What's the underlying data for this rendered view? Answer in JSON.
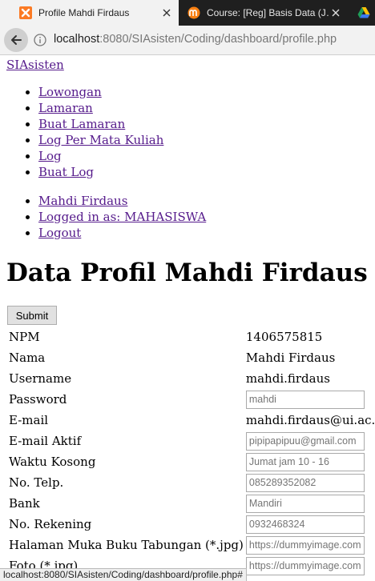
{
  "browser": {
    "tabs": [
      {
        "title": "Profile Mahdi Firdaus",
        "favicon": "xampp-icon"
      },
      {
        "title": "Course: [Reg] Basis Data (J…",
        "favicon": "moodle-icon"
      }
    ],
    "url": {
      "host": "localhost",
      "rest": ":8080/SIAsisten/Coding/dashboard/profile.php"
    },
    "status_url": "localhost:8080/SIAsisten/Coding/dashboard/profile.php#"
  },
  "nav": {
    "brand": "SIAsisten",
    "menu": [
      "Lowongan",
      "Lamaran",
      "Buat Lamaran",
      "Log Per Mata Kuliah",
      "Log",
      "Buat Log"
    ],
    "user_menu": [
      "Mahdi Firdaus",
      "Logged in as: MAHASISWA",
      "Logout"
    ]
  },
  "page": {
    "heading": "Data Profil Mahdi Firdaus",
    "submit_label": "Submit"
  },
  "profile": {
    "npm": {
      "label": "NPM",
      "value": "1406575815"
    },
    "nama": {
      "label": "Nama",
      "value": "Mahdi Firdaus"
    },
    "username": {
      "label": "Username",
      "value": "mahdi.firdaus"
    },
    "password": {
      "label": "Password",
      "placeholder": "mahdi"
    },
    "email": {
      "label": "E-mail",
      "value": "mahdi.firdaus@ui.ac.id"
    },
    "email_aktif": {
      "label": "E-mail Aktif",
      "placeholder": "pipipapipuu@gmail.com"
    },
    "waktu_kosong": {
      "label": "Waktu Kosong",
      "placeholder": "Jumat jam 10 - 16"
    },
    "telp": {
      "label": "No. Telp.",
      "placeholder": "085289352082"
    },
    "bank": {
      "label": "Bank",
      "placeholder": "Mandiri"
    },
    "rekening": {
      "label": "No. Rekening",
      "placeholder": "0932468324"
    },
    "buku_tabungan": {
      "label": "Halaman Muka Buku Tabungan (*.jpg)",
      "placeholder": "https://dummyimage.com"
    },
    "foto": {
      "label": "Foto (*.jpg)",
      "placeholder": "https://dummyimage.com"
    }
  }
}
